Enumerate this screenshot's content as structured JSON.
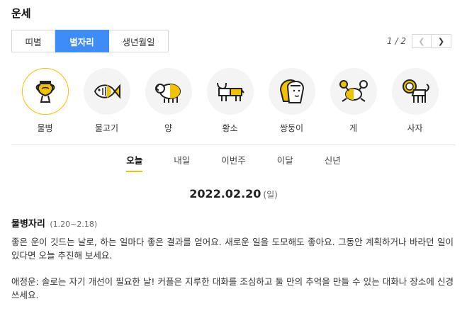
{
  "page": {
    "title": "운세"
  },
  "tabs": [
    {
      "label": "띠별",
      "active": false
    },
    {
      "label": "별자리",
      "active": true
    },
    {
      "label": "생년월일",
      "active": false
    }
  ],
  "pager": {
    "text": "1 / 2",
    "prev_icon": "chevron-left-icon",
    "next_icon": "chevron-right-icon"
  },
  "signs": [
    {
      "label": "물병",
      "icon": "aquarius-icon",
      "selected": true
    },
    {
      "label": "물고기",
      "icon": "pisces-icon",
      "selected": false
    },
    {
      "label": "양",
      "icon": "aries-icon",
      "selected": false
    },
    {
      "label": "황소",
      "icon": "taurus-icon",
      "selected": false
    },
    {
      "label": "쌍둥이",
      "icon": "gemini-icon",
      "selected": false
    },
    {
      "label": "게",
      "icon": "cancer-icon",
      "selected": false
    },
    {
      "label": "사자",
      "icon": "leo-icon",
      "selected": false
    }
  ],
  "periods": [
    {
      "label": "오늘",
      "active": true
    },
    {
      "label": "내일",
      "active": false
    },
    {
      "label": "이번주",
      "active": false
    },
    {
      "label": "이달",
      "active": false
    },
    {
      "label": "신년",
      "active": false
    }
  ],
  "fortune": {
    "date": "2022.02.20",
    "day": "(일)",
    "sign_name": "물병자리",
    "sign_range": "(1.20~2.18)",
    "paragraph1": "좋은 운이 깃드는 날로, 하는 일마다 좋은 결과를 얻어요. 새로운 일을 도모해도 좋아요. 그동안 계획하거나 바라던 일이 있다면 오늘 추진해 보세요.",
    "paragraph2": "애정운: 솔로는 자기 개선이 필요한 날! 커플은 지루한 대화를 조심하고 둘 만의 추억을 만들 수 있는 대화나 장소에 신경 쓰세요."
  },
  "colors": {
    "accent_blue": "#3d8cf7",
    "accent_yellow": "#f2c200"
  }
}
